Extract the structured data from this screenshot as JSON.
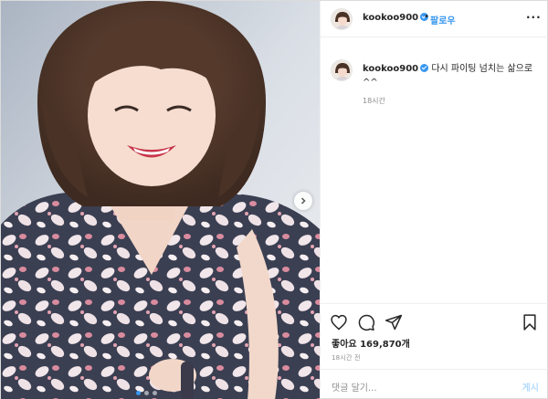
{
  "header": {
    "username": "kookoo900",
    "separator": "•",
    "follow_label": "팔로우",
    "more_icon": "more-options-icon",
    "more_label": "···"
  },
  "caption": {
    "username": "kookoo900",
    "text": "다시 파이팅 넘치는 삶으로^^",
    "time": "18시간"
  },
  "photo": {
    "next_icon": "chevron-right-icon",
    "carousel_position": 1
  },
  "actions": {
    "like_icon": "heart-icon",
    "comment_icon": "comment-bubble-icon",
    "share_icon": "paper-plane-icon",
    "save_icon": "bookmark-icon",
    "likes_prefix": "좋아요",
    "likes_count": "169,870개",
    "post_time": "18시간 전"
  },
  "comment": {
    "placeholder": "댓글 달기...",
    "send_label": "게시"
  },
  "colors": {
    "accent": "#3897f0",
    "muted": "#8e8e8e",
    "border": "#dbdbdb",
    "send_disabled": "#b3dbff"
  }
}
